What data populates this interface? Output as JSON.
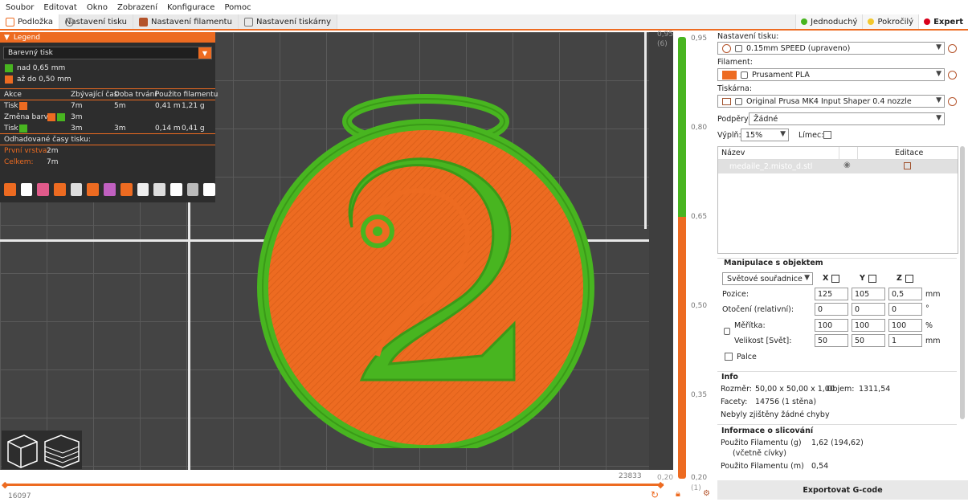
{
  "menu": [
    "Soubor",
    "Editovat",
    "Okno",
    "Zobrazení",
    "Konfigurace",
    "Pomoc"
  ],
  "tabs": [
    {
      "label": "Podložka",
      "icon": "bed-icon",
      "active": true
    },
    {
      "label": "Nastavení tisku",
      "icon": "gear-icon",
      "active": false
    },
    {
      "label": "Nastavení filamentu",
      "icon": "spool-icon",
      "active": false
    },
    {
      "label": "Nastavení tiskárny",
      "icon": "printer-icon",
      "active": false
    }
  ],
  "modes": [
    {
      "label": "Jednoduchý",
      "color": "#48b520"
    },
    {
      "label": "Pokročilý",
      "color": "#f2c82f"
    },
    {
      "label": "Expert",
      "color": "#d9001b"
    }
  ],
  "legend": {
    "title": "Legend",
    "view_select": "Barevný tisk",
    "ranges": [
      {
        "label": "nad 0,65 mm",
        "color": "#48b520"
      },
      {
        "label": "až do 0,50 mm",
        "color": "#ed6b21"
      }
    ],
    "columns": [
      "Akce",
      "Zbývající čas",
      "Doba trvání",
      "Použito filamentu"
    ],
    "rows": [
      {
        "action": "Tisk",
        "remaining": "7m",
        "duration": "5m",
        "length": "0,41 m",
        "weight": "1,21 g"
      },
      {
        "action": "Změna barvy",
        "remaining": "3m",
        "duration": "",
        "length": "",
        "weight": ""
      },
      {
        "action": "Tisk",
        "remaining": "3m",
        "duration": "3m",
        "length": "0,14 m",
        "weight": "0,41 g"
      }
    ],
    "estimated_title": "Odhadované časy tisku:",
    "first_layer_label": "První vrstva:",
    "first_layer_value": "2m",
    "total_label": "Celkem:",
    "total_value": "7m"
  },
  "layer_slider": {
    "top_value": "0,95",
    "top_index": "(6)",
    "bottom_value": "0,20",
    "bottom_index": "(1)",
    "ticks": [
      "0,95",
      "0,80",
      "0,65",
      "0,50",
      "0,35",
      "0,20"
    ]
  },
  "move_slider": {
    "start": "16097",
    "end": "23833"
  },
  "right_panel": {
    "print_settings_label": "Nastavení tisku:",
    "print_settings_value": "0.15mm SPEED (upraveno)",
    "filament_label": "Filament:",
    "filament_value": "Prusament PLA",
    "filament_color": "#ed6b21",
    "printer_label": "Tiskárna:",
    "printer_value": "Original Prusa MK4 Input Shaper 0.4 nozzle",
    "supports_label": "Podpěry:",
    "supports_value": "Žádné",
    "infill_label": "Výplň:",
    "infill_value": "15%",
    "brim_label": "Límec:",
    "objlist_col_name": "Název",
    "objlist_col_edit": "Editace",
    "object_name": "medaile_2.misto_d.stl",
    "manip_title": "Manipulace s objektem",
    "coord_select": "Světové souřadnice",
    "axis_x": "X",
    "axis_y": "Y",
    "axis_z": "Z",
    "position_label": "Pozice:",
    "position": [
      "125",
      "105",
      "0,5"
    ],
    "position_unit": "mm",
    "rotation_label": "Otočení (relativní):",
    "rotation": [
      "0",
      "0",
      "0"
    ],
    "rotation_unit": "°",
    "scale_label": "Měřítka:",
    "scale": [
      "100",
      "100",
      "100"
    ],
    "scale_unit": "%",
    "size_label": "Velikost [Svět]:",
    "size": [
      "50",
      "50",
      "1"
    ],
    "size_unit": "mm",
    "inches_label": "Palce",
    "info_title": "Info",
    "size_info_label": "Rozměr:",
    "size_info_value": "50,00 x 50,00 x 1,00",
    "volume_label": "Objem:",
    "volume_value": "1311,54",
    "facets_label": "Facety:",
    "facets_value": "14756 (1 stěna)",
    "errors_text": "Nebyly zjištěny žádné chyby",
    "slice_title": "Informace o slicování",
    "filament_g_label": "Použito Filamentu (g)",
    "filament_g_sub": "(včetně cívky)",
    "filament_g_value": "1,62 (194,62)",
    "filament_m_label": "Použito Filamentu (m)",
    "filament_m_value": "0,54",
    "export_label": "Exportovat G-code"
  }
}
